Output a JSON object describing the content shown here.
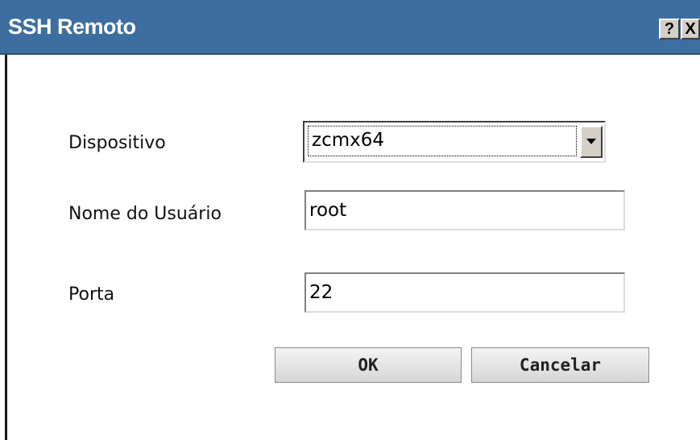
{
  "window": {
    "title": "SSH Remoto",
    "help_glyph": "?",
    "close_glyph": "X"
  },
  "form": {
    "device": {
      "label": "Dispositivo",
      "value": "zcmx64"
    },
    "username": {
      "label": "Nome do Usuário",
      "value": "root"
    },
    "port": {
      "label": "Porta",
      "value": "22"
    }
  },
  "buttons": {
    "ok": "OK",
    "cancel": "Cancelar"
  },
  "colors": {
    "titlebar": "#3d6e9f"
  }
}
